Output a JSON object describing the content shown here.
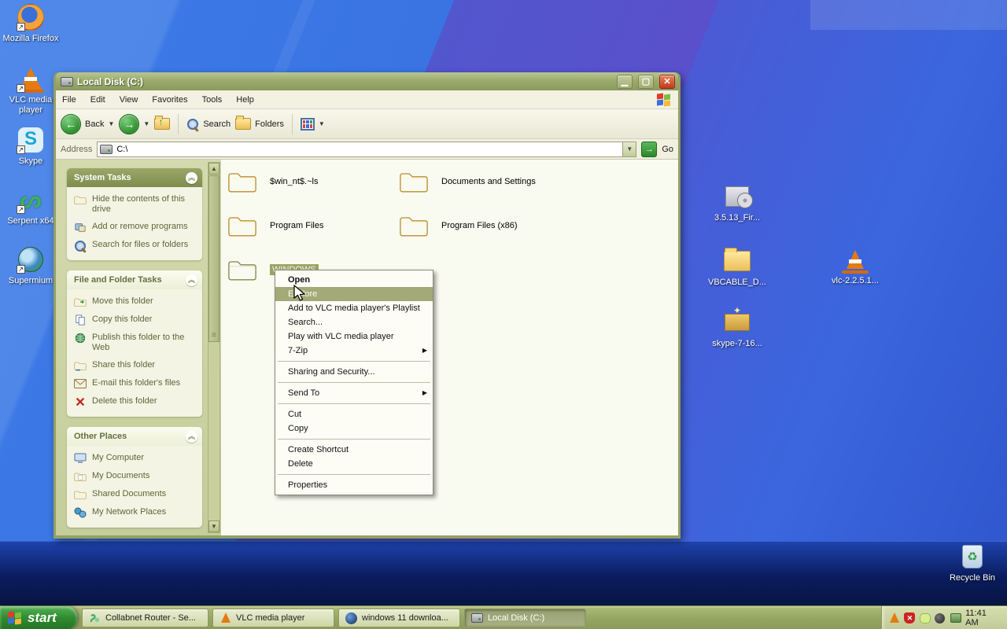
{
  "desktop_icons": {
    "left": [
      {
        "label": "Mozilla Firefox"
      },
      {
        "label": "VLC media player"
      },
      {
        "label": "Skype"
      },
      {
        "label": "Serpent x64"
      },
      {
        "label": "Supermium"
      }
    ],
    "right": [
      {
        "label": "3.5.13_Fir..."
      },
      {
        "label": "VBCABLE_D..."
      },
      {
        "label": "vlc-2.2.5.1..."
      },
      {
        "label": "skype-7-16..."
      },
      {
        "label": "Recycle Bin"
      }
    ]
  },
  "window": {
    "title": "Local Disk (C:)",
    "menu": [
      "File",
      "Edit",
      "View",
      "Favorites",
      "Tools",
      "Help"
    ],
    "toolbar": {
      "back": "Back",
      "search": "Search",
      "folders": "Folders"
    },
    "address": {
      "label": "Address",
      "value": "C:\\",
      "go_label": "Go"
    },
    "sidebar": {
      "system_tasks": {
        "title": "System Tasks",
        "items": [
          "Hide the contents of this drive",
          "Add or remove programs",
          "Search for files or folders"
        ]
      },
      "file_folder_tasks": {
        "title": "File and Folder Tasks",
        "items": [
          "Move this folder",
          "Copy this folder",
          "Publish this folder to the Web",
          "Share this folder",
          "E-mail this folder's files",
          "Delete this folder"
        ]
      },
      "other_places": {
        "title": "Other Places",
        "items": [
          "My Computer",
          "My Documents",
          "Shared Documents",
          "My Network Places"
        ]
      }
    },
    "files": [
      "$win_nt$.~ls",
      "Documents and Settings",
      "Program Files",
      "Program Files (x86)",
      "WINDOWS"
    ]
  },
  "context_menu": {
    "items": [
      "Open",
      "Explore",
      "Add to VLC media player's Playlist",
      "Search...",
      "Play with VLC media player",
      "7-Zip",
      "Sharing and Security...",
      "Send To",
      "Cut",
      "Copy",
      "Create Shortcut",
      "Delete",
      "Properties"
    ]
  },
  "taskbar": {
    "start_label": "start",
    "tasks": [
      {
        "label": "Collabnet Router - Se..."
      },
      {
        "label": "VLC media player"
      },
      {
        "label": "windows 11 downloa..."
      },
      {
        "label": "Local Disk (C:)",
        "active": true
      }
    ],
    "clock": "11:41 AM"
  },
  "colors": {
    "titlebar_olive": "#8c9a60",
    "selection_olive": "#a3a977",
    "taskbar_green": "#2f8b2f",
    "close_red": "#c0391b",
    "wallpaper_blue": "#3c7ce8",
    "wallpaper_purple": "#5a50cc"
  }
}
